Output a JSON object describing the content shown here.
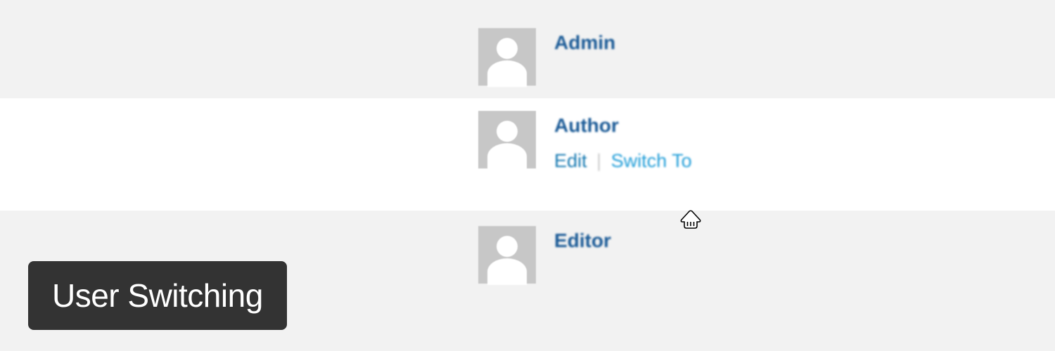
{
  "title": "User Switching",
  "users": [
    {
      "name": "Admin"
    },
    {
      "name": "Author",
      "actions": {
        "edit": "Edit",
        "switch": "Switch To"
      }
    },
    {
      "name": "Editor"
    }
  ]
}
